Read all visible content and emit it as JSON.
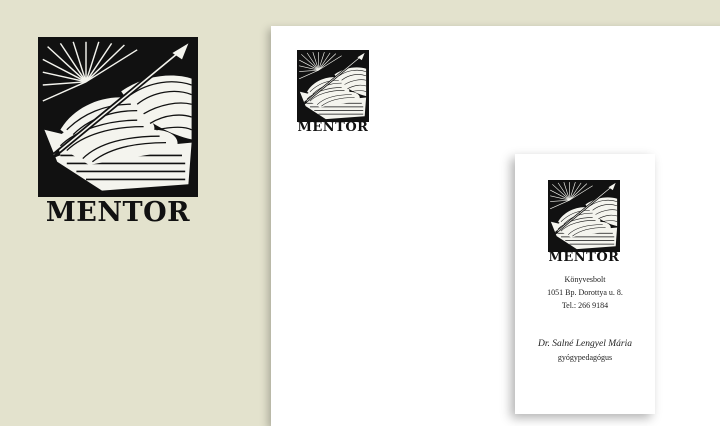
{
  "colors": {
    "background": "#e3e2cd",
    "paper": "#ffffff",
    "ink": "#111111"
  },
  "brand": {
    "name": "MENTOR",
    "logo_icon": "hand-writing-with-pen-woodcut-icon"
  },
  "card": {
    "shop": "Könyvesbolt",
    "address": "1051 Bp. Dorottya u. 8.",
    "phone": "Tel.: 266 9184",
    "person_name": "Dr. Salné Lengyel Mária",
    "person_title": "gyógypedagógus"
  }
}
